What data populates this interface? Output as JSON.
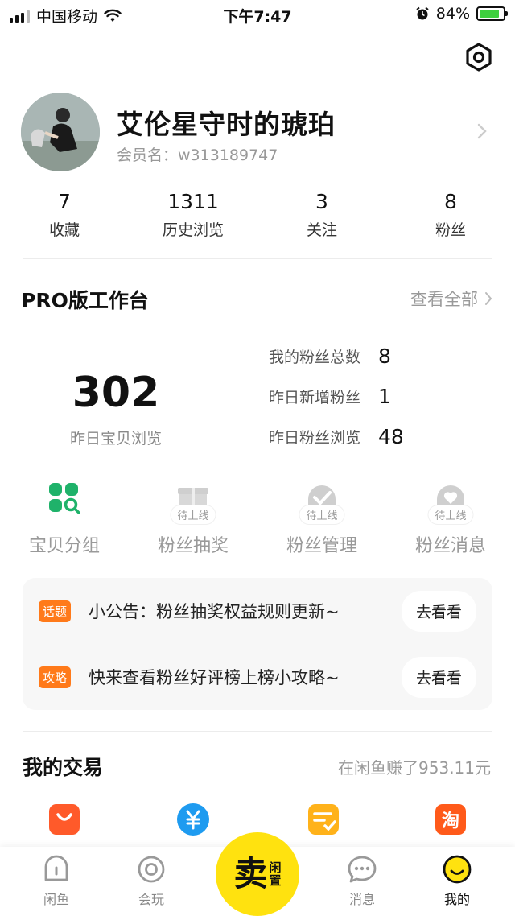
{
  "status_bar": {
    "carrier": "中国移动",
    "time": "下午7:47",
    "battery_text": "84%"
  },
  "profile": {
    "username": "艾伦星守时的琥珀",
    "member_id": "会员名：w313189747"
  },
  "stats": [
    {
      "num": "7",
      "label": "收藏"
    },
    {
      "num": "1311",
      "label": "历史浏览"
    },
    {
      "num": "3",
      "label": "关注"
    },
    {
      "num": "8",
      "label": "粉丝"
    }
  ],
  "pro": {
    "title": "PRO版工作台",
    "view_all": "查看全部",
    "big_value": "302",
    "big_label": "昨日宝贝浏览",
    "fan_stats": [
      {
        "label": "我的粉丝总数",
        "value": "8"
      },
      {
        "label": "昨日新增粉丝",
        "value": "1"
      },
      {
        "label": "昨日粉丝浏览",
        "value": "48"
      }
    ]
  },
  "tools": [
    {
      "label": "宝贝分组",
      "icon": "grid-search-icon",
      "badge": ""
    },
    {
      "label": "粉丝抽奖",
      "icon": "gift-icon",
      "badge": "待上线"
    },
    {
      "label": "粉丝管理",
      "icon": "check-shield-icon",
      "badge": "待上线"
    },
    {
      "label": "粉丝消息",
      "icon": "heart-chat-icon",
      "badge": "待上线"
    }
  ],
  "notices": [
    {
      "tag": "话题",
      "text": "小公告：粉丝抽奖权益规则更新~",
      "button": "去看看"
    },
    {
      "tag": "攻略",
      "text": "快来查看粉丝好评榜上榜小攻略~",
      "button": "去看看"
    }
  ],
  "trades": {
    "title": "我的交易",
    "earned": "在闲鱼赚了953.11元",
    "icons": [
      "shopping-bag-icon",
      "yuan-icon",
      "edit-note-icon",
      "taobao-icon"
    ]
  },
  "bottom_nav": {
    "items": [
      {
        "label": "闲鱼",
        "icon": "home-icon"
      },
      {
        "label": "会玩",
        "icon": "play-circle-icon"
      },
      {
        "label": "消息",
        "icon": "message-icon"
      },
      {
        "label": "我的",
        "icon": "smiley-icon"
      }
    ],
    "sell_main": "卖",
    "sell_sub1": "闲",
    "sell_sub2": "置"
  },
  "colors": {
    "accent_yellow": "#ffe20f",
    "tag_orange": "#ff7a1a",
    "green": "#1fb26a",
    "blue": "#1e9bf0"
  }
}
